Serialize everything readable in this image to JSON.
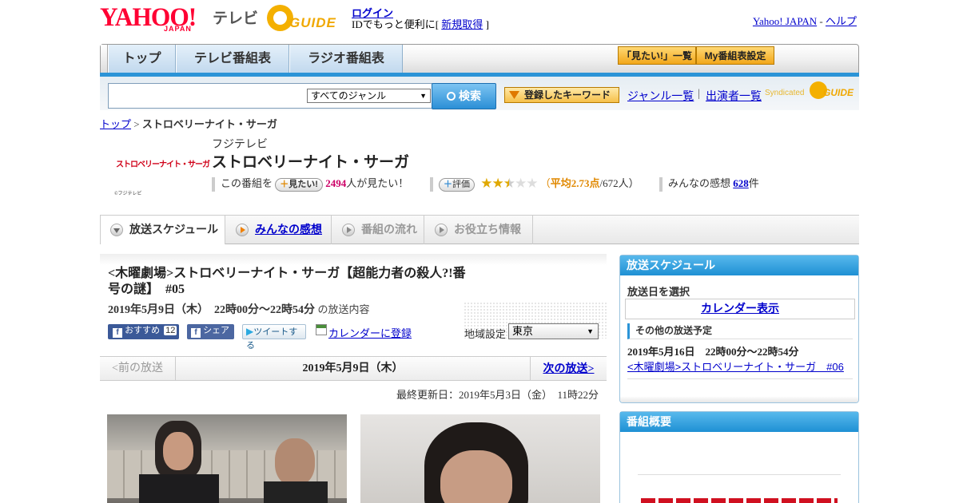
{
  "header": {
    "yahoo_logo": "YAHOO!",
    "yahoo_logo_sub": "JAPAN",
    "service_name": "テレビ",
    "gguide_logo": "GUIDE",
    "login_link": "ログイン",
    "login_sub_prefix": "IDでもっと便利に[",
    "signup_link": "新規取得",
    "login_sub_suffix": "]",
    "yahoo_japan_link": "Yahoo! JAPAN",
    "link_separator": "-",
    "help_link": "ヘルプ"
  },
  "nav": {
    "tabs": [
      {
        "label": "トップ"
      },
      {
        "label": "テレビ番組表"
      },
      {
        "label": "ラジオ番組表"
      }
    ],
    "want_list_button": "「見たい!」一覧",
    "my_program_button": "My番組表設定"
  },
  "search": {
    "value": "",
    "genre_selected": "すべてのジャンル",
    "search_button": "検索",
    "keyword_button": "登録したキーワード",
    "genre_list_link": "ジャンル一覧",
    "divider": "|",
    "performer_list_link": "出演者一覧",
    "syndicated_label": "Syndicated"
  },
  "breadcrumb": {
    "top_link": "トップ",
    "separator": ">",
    "current": "ストロベリーナイト・サーガ"
  },
  "program": {
    "logo_text": "ストロベリーナイト・サーガ",
    "logo_copyright": "©フジテレビ",
    "channel": "フジテレビ",
    "title": "ストロベリーナイト・サーガ",
    "want_prefix": "この番組を",
    "want_button": "見たい!",
    "want_count": "2494",
    "want_suffix": "人が見たい！",
    "rate_button": "評価",
    "rating_stars": 2.5,
    "rating_paren_open": "（",
    "rating_avg_label": "平均2.73点",
    "rating_count": "/672人）",
    "impressions_label": "みんなの感想",
    "impressions_count": "628",
    "impressions_suffix": "件"
  },
  "subtabs": [
    {
      "label": "放送スケジュール"
    },
    {
      "label": "みんなの感想"
    },
    {
      "label": "番組の流れ"
    },
    {
      "label": "お役立ち情報"
    }
  ],
  "episode": {
    "title_line1": "<木曜劇場>ストロベリーナイト・サーガ【超能力者の殺人?!番",
    "title_line2": "号の謎】　#05",
    "datetime": "2019年5月9日（木）　22時00分～22時54分",
    "datetime_suffix": "の放送内容",
    "recommend_button": "おすすめ",
    "recommend_count": "12",
    "share_button": "シェア",
    "tweet_button": "ツイートする",
    "calendar_link": "カレンダーに登録",
    "region_label": "地域設定",
    "region_selected": "東京",
    "prev_broadcast": "<前の放送",
    "current_date": "2019年5月9日（木）",
    "next_broadcast": "次の放送>",
    "last_updated": "最終更新日：2019年5月3日（金）　11時22分"
  },
  "sidebar": {
    "schedule_heading": "放送スケジュール",
    "select_date_label": "放送日を選択",
    "calendar_link": "カレンダー表示",
    "other_schedule_heading": "その他の放送予定",
    "next_datetime": "2019年5月16日　22時00分～22時54分",
    "next_title_link": "<木曜劇場>ストロベリーナイト・サーガ　#06",
    "summary_heading": "番組概要"
  },
  "colors": {
    "link": "#0000cc",
    "accent_blue": "#2b94d7",
    "want_count": "#cc0066",
    "rating_orange": "#e08800",
    "yahoo_red": "#ff0033"
  }
}
